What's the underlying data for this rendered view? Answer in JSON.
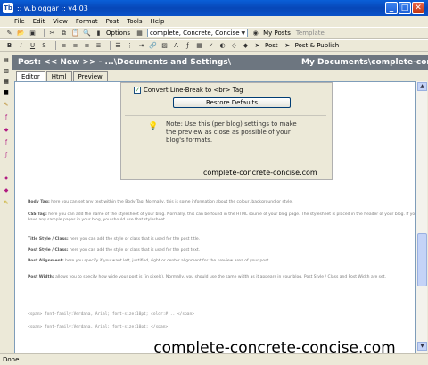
{
  "window": {
    "title": ":: w.bloggar :: v4.03",
    "app_icon": "Tb",
    "controls": {
      "minimize": "_",
      "maximize": "□",
      "close": "✕"
    }
  },
  "menu": [
    "File",
    "Edit",
    "View",
    "Format",
    "Post",
    "Tools",
    "Help"
  ],
  "toolbar1": {
    "options_label": "Options",
    "blog_combo": "complete, Concrete, Concise",
    "my_posts_label": "My Posts",
    "template_label": "Template"
  },
  "toolbar2": {
    "post_label": "Post",
    "post_publish_label": "Post & Publish"
  },
  "post_header": {
    "left": "Post: << New >> - ...\\Documents and Settings\\",
    "right": "My Documents\\complete-conc"
  },
  "tabs": [
    "Editor",
    "Html",
    "Preview"
  ],
  "screenshot": {
    "checkbox_label": "Convert Line-Break to <br> Tag",
    "restore_button": "Restore Defaults",
    "note": "Note: Use this (per blog) settings to make the preview as close as possible of your blog's formats.",
    "caption": "complete-concrete-concise.com"
  },
  "paragraphs": [
    {
      "lead": "Body Tag:",
      "text": "here you can set any text within the Body Tag. Normally, this is some information about the colour, background or style."
    },
    {
      "lead": "CSS Tag:",
      "text": "here you can add the name of the stylesheet of your blog. Normally, this can be found in the HTML source of your blog page. The stylesheet is placed in the header of your blog. If you have any sample pages in your blog, you should use that stylesheet."
    },
    {
      "lead": "Title Style / Class:",
      "text": "here you can add the style or class that is used for the post title."
    },
    {
      "lead": "Post Style / Class:",
      "text": "here you can add the style or class that is used for the post text."
    },
    {
      "lead": "Post Alignment:",
      "text": "here you specify if you want left, justified, right or center alignment for the preview area of your post."
    },
    {
      "lead": "Post Width:",
      "text": "allows you to specify how wide your post is (in pixels). Normally, you should use the same width as it appears in your blog. Post Style / Class and Post Width are set."
    }
  ],
  "code_lines": [
    "<span> font-family:Verdana, Arial; font-size:10pt; color:#... </span>",
    "<span> font-family:Verdana, Arial; font-size:10pt; </span>"
  ],
  "watermark": "complete-concrete-concise.com",
  "status": "Done"
}
